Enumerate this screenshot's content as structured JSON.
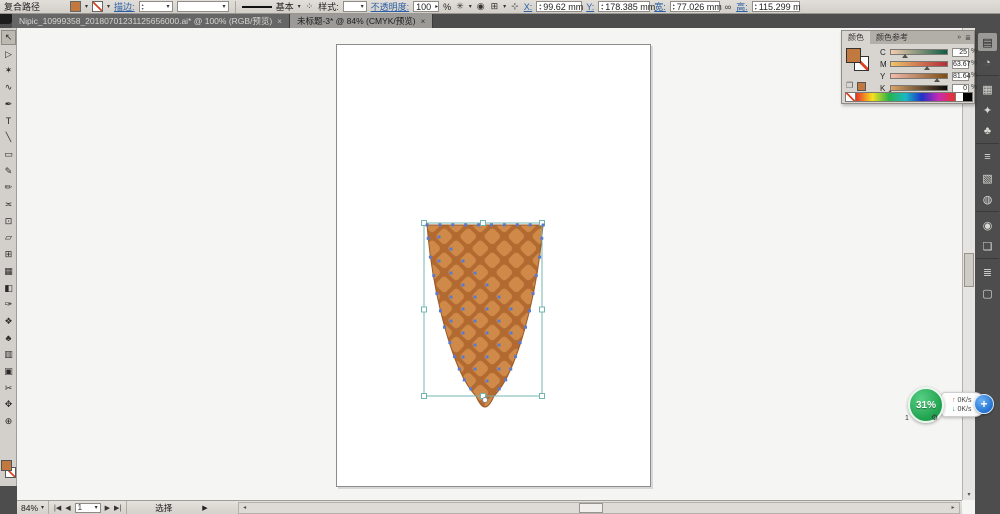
{
  "control_bar": {
    "context_label": "复合路径",
    "stroke_link": "描边:",
    "brush_name": "基本",
    "style_label": "样式:",
    "opacity_link": "不透明度:",
    "opacity_value": "100",
    "percent": "%",
    "x_label": "X:",
    "x_value": "99.62 mm",
    "y_label": "Y:",
    "y_value": "178.385 mm",
    "w_label": "宽:",
    "w_value": "77.026 mm",
    "h_label": "高:",
    "h_value": "115.299 m",
    "fill_color": "#c1793f"
  },
  "icons": {
    "dropdown": "▾",
    "spinner_up": "▴",
    "spinner_down": "▾",
    "spinner_right": "▸",
    "select_similar": "✳",
    "recolor_artwork": "◉",
    "align_options": "⊞",
    "transform_options": "⊹",
    "constrain_link": "∞",
    "brush_list": "⁘",
    "scroll_up": "▴",
    "scroll_down": "▾",
    "scroll_left": "◂",
    "scroll_right": "▸"
  },
  "doc_tabs": [
    {
      "label": "Nipic_10999358_20180701231125656000.ai* @ 100% (RGB/预览)",
      "close": "×",
      "active": false
    },
    {
      "label": "未标题-3* @ 84% (CMYK/预览)",
      "close": "×",
      "active": true
    }
  ],
  "toolbar": {
    "tools": [
      {
        "name": "selection-tool",
        "glyph": "↖",
        "active": true
      },
      {
        "name": "direct-selection-tool",
        "glyph": "▷",
        "active": false
      },
      {
        "name": "magic-wand-tool",
        "glyph": "✶",
        "active": false
      },
      {
        "name": "lasso-tool",
        "glyph": "∿",
        "active": false
      },
      {
        "name": "pen-tool",
        "glyph": "✒",
        "active": false
      },
      {
        "name": "type-tool",
        "glyph": "T",
        "active": false
      },
      {
        "name": "line-segment-tool",
        "glyph": "╲",
        "active": false
      },
      {
        "name": "rectangle-tool",
        "glyph": "▭",
        "active": false
      },
      {
        "name": "paintbrush-tool",
        "glyph": "✎",
        "active": false
      },
      {
        "name": "pencil-tool",
        "glyph": "✏",
        "active": false
      },
      {
        "name": "width-tool",
        "glyph": "≍",
        "active": false
      },
      {
        "name": "free-transform-tool",
        "glyph": "⊡",
        "active": false
      },
      {
        "name": "shape-builder-tool",
        "glyph": "▱",
        "active": false
      },
      {
        "name": "perspective-grid-tool",
        "glyph": "⊞",
        "active": false
      },
      {
        "name": "mesh-tool",
        "glyph": "▦",
        "active": false
      },
      {
        "name": "gradient-tool",
        "glyph": "◧",
        "active": false
      },
      {
        "name": "eyedropper-tool",
        "glyph": "✑",
        "active": false
      },
      {
        "name": "blend-tool",
        "glyph": "❖",
        "active": false
      },
      {
        "name": "symbol-sprayer-tool",
        "glyph": "♣",
        "active": false
      },
      {
        "name": "column-graph-tool",
        "glyph": "▥",
        "active": false
      },
      {
        "name": "artboard-tool",
        "glyph": "▣",
        "active": false
      },
      {
        "name": "slice-tool",
        "glyph": "✂",
        "active": false
      },
      {
        "name": "hand-tool",
        "glyph": "✥",
        "active": false
      },
      {
        "name": "zoom-tool",
        "glyph": "⊕",
        "active": false
      }
    ]
  },
  "color_panel": {
    "tab_color": "颜色",
    "tab_guide": "颜色参考",
    "collapse_icon": "»",
    "menu_icon": "≣",
    "unit": "%",
    "fill_color": "#c1793f",
    "sliders": [
      {
        "label": "C",
        "value": "25",
        "pct": 25,
        "g_from": "#f6cdb0",
        "g_to": "#0d5c45"
      },
      {
        "label": "M",
        "value": "63.67",
        "pct": 63.67,
        "g_from": "#eec36a",
        "g_to": "#b32c3a"
      },
      {
        "label": "Y",
        "value": "81.64",
        "pct": 81.64,
        "g_from": "#f3b9ad",
        "g_to": "#7d4d12"
      },
      {
        "label": "K",
        "value": "0",
        "pct": 0,
        "g_from": "#dba467",
        "g_to": "#0a0a0a"
      }
    ]
  },
  "dock": {
    "icons": [
      {
        "name": "color-panel-icon",
        "glyph": "▤",
        "active": true,
        "sep": false
      },
      {
        "name": "color-guide-panel-icon",
        "glyph": "◔",
        "active": false,
        "sep": false
      },
      {
        "name": "swatches-panel-icon",
        "glyph": "▦",
        "active": false,
        "sep": true
      },
      {
        "name": "brushes-panel-icon",
        "glyph": "✦",
        "active": false,
        "sep": false
      },
      {
        "name": "symbols-panel-icon",
        "glyph": "♣",
        "active": false,
        "sep": false
      },
      {
        "name": "stroke-panel-icon",
        "glyph": "≡",
        "active": false,
        "sep": true
      },
      {
        "name": "gradient-panel-icon",
        "glyph": "▧",
        "active": false,
        "sep": false
      },
      {
        "name": "transparency-panel-icon",
        "glyph": "◍",
        "active": false,
        "sep": false
      },
      {
        "name": "appearance-panel-icon",
        "glyph": "◉",
        "active": false,
        "sep": true
      },
      {
        "name": "graphic-styles-panel-icon",
        "glyph": "❏",
        "active": false,
        "sep": false
      },
      {
        "name": "layers-panel-icon",
        "glyph": "≣",
        "active": false,
        "sep": true
      },
      {
        "name": "artboards-panel-icon",
        "glyph": "▢",
        "active": false,
        "sep": false
      }
    ]
  },
  "status_bar": {
    "zoom_value": "84%",
    "nav_first": "|◀",
    "nav_prev": "◀",
    "artboard_value": "1",
    "nav_next": "▶",
    "nav_last": "▶|",
    "status_text": "选择",
    "status_arrow": "▶"
  },
  "overlay": {
    "percent": "31%",
    "up_arrow": "↑",
    "up_value": "0K/s",
    "down_arrow": "↓",
    "down_value": "0K/s",
    "badge": "1",
    "gear": "⚙",
    "plus": "+"
  },
  "artwork": {
    "cone_base": "#b26a31",
    "cone_diamond": "#cf8a49",
    "cone_outline": "#9a5a28",
    "anchor_color": "#5b79cc",
    "selection_color": "#74b4b0"
  }
}
